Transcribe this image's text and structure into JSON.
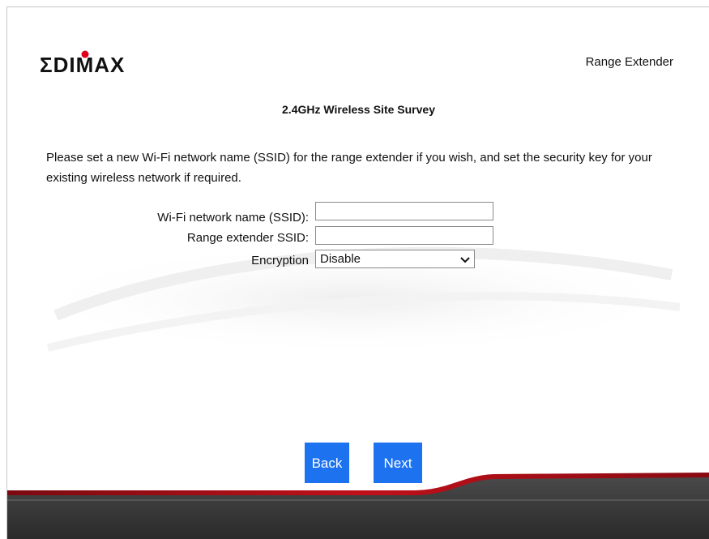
{
  "header": {
    "brand": "EDIMAX",
    "product": "Range Extender"
  },
  "page": {
    "title": "2.4GHz  Wireless Site Survey",
    "description": "Please set a new Wi-Fi network name (SSID) for the range extender if you wish, and set the security key for your existing wireless network if required."
  },
  "form": {
    "ssid_label": "Wi-Fi network name (SSID):",
    "ssid_value": "",
    "ext_ssid_label": "Range extender SSID:",
    "ext_ssid_value": "",
    "encryption_label": "Encryption",
    "encryption_value": "Disable"
  },
  "buttons": {
    "back": "Back",
    "next": "Next"
  },
  "colors": {
    "button": "#1d72f0",
    "logo_dot": "#e0001b",
    "footer_stripe": "#c0101a"
  }
}
